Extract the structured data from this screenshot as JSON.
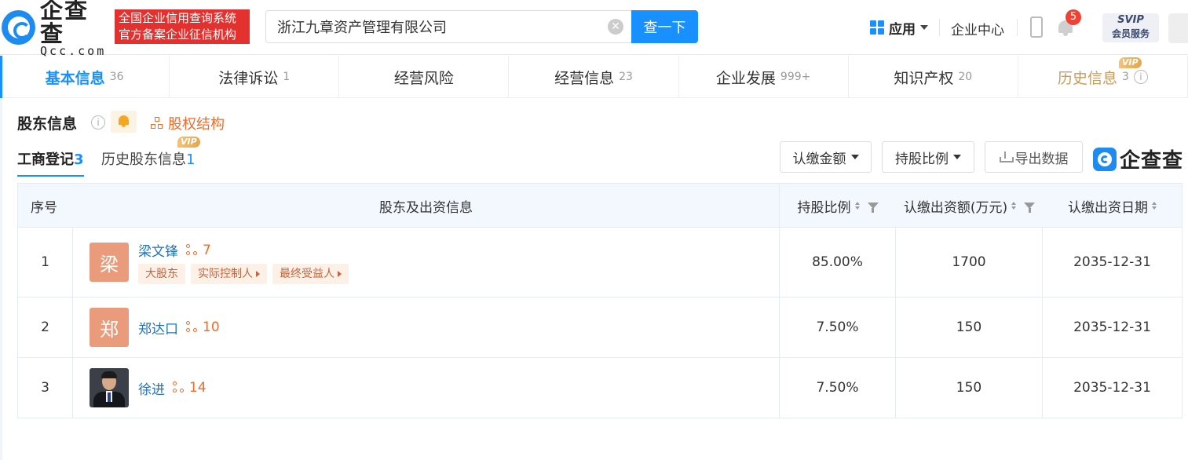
{
  "header": {
    "logo_cn": "企查查",
    "logo_en": "Qcc.com",
    "badge_line1": "全国企业信用查询系统",
    "badge_line2": "官方备案企业征信机构",
    "search_value": "浙江九章资产管理有限公司",
    "search_button": "查一下",
    "apps_label": "应用",
    "enterprise_center": "企业中心",
    "notification_count": "5",
    "svip_line1": "SVIP",
    "svip_line2": "会员服务"
  },
  "tabs": [
    {
      "label": "基本信息",
      "count": "36",
      "active": true
    },
    {
      "label": "法律诉讼",
      "count": "1"
    },
    {
      "label": "经营风险",
      "count": ""
    },
    {
      "label": "经营信息",
      "count": "23"
    },
    {
      "label": "企业发展",
      "count": "999+"
    },
    {
      "label": "知识产权",
      "count": "20"
    },
    {
      "label": "历史信息",
      "count": "3",
      "vip": "VIP"
    }
  ],
  "section": {
    "title": "股东信息",
    "equity_label": "股权结构",
    "subtab1_label": "工商登记",
    "subtab1_count": "3",
    "subtab2_label": "历史股东信息",
    "subtab2_count": "1",
    "subtab2_vip": "VIP",
    "filter_amount": "认缴金额",
    "filter_ratio": "持股比例",
    "export": "导出数据",
    "watermark": "企查查"
  },
  "table": {
    "headers": {
      "index": "序号",
      "shareholder": "股东及出资信息",
      "ratio": "持股比例",
      "amount": "认缴出资额(万元)",
      "date": "认缴出资日期"
    },
    "rows": [
      {
        "index": "1",
        "avatar_char": "梁",
        "name": "梁文锋",
        "relations": "7",
        "tags": [
          "大股东",
          "实际控制人",
          "最终受益人"
        ],
        "ratio": "85.00%",
        "amount": "1700",
        "date": "2035-12-31"
      },
      {
        "index": "2",
        "avatar_char": "郑",
        "name": "郑达口",
        "relations": "10",
        "tags": [],
        "ratio": "7.50%",
        "amount": "150",
        "date": "2035-12-31"
      },
      {
        "index": "3",
        "avatar_char": "",
        "name": "徐进",
        "relations": "14",
        "tags": [],
        "ratio": "7.50%",
        "amount": "150",
        "date": "2035-12-31"
      }
    ]
  },
  "colors": {
    "primary": "#1890ff",
    "accent_orange": "#f06b2a",
    "brand_red": "#e2312f",
    "vip_gold": "#c89b5f"
  }
}
